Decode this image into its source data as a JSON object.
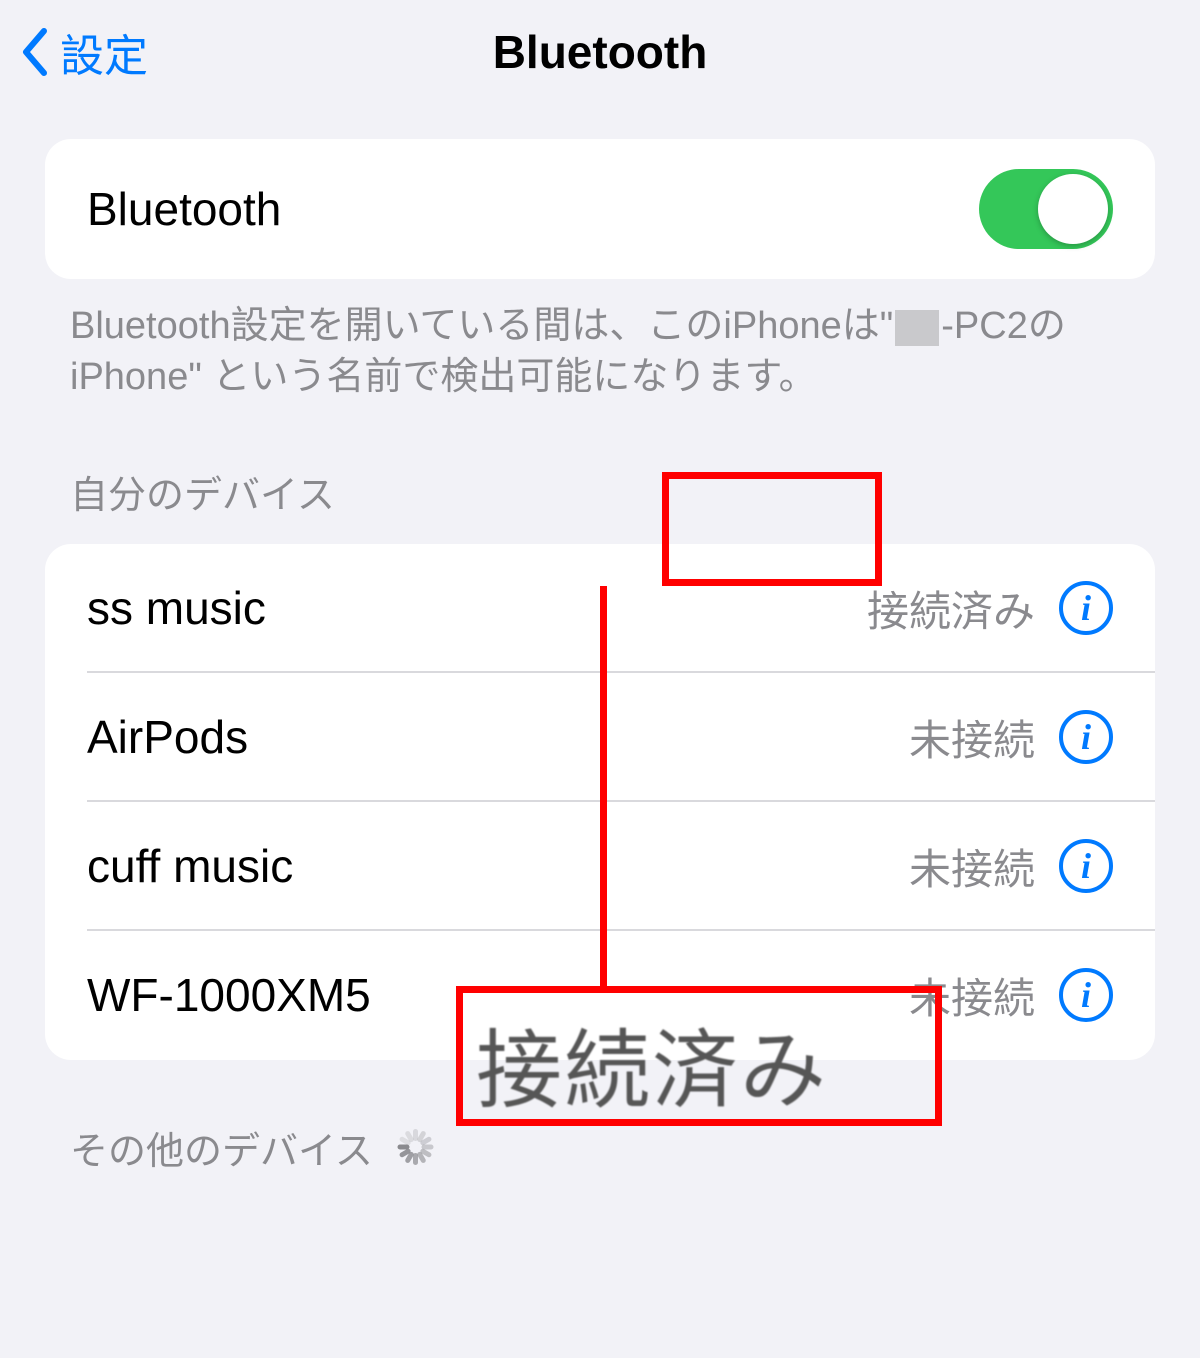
{
  "header": {
    "back_label": "設定",
    "title": "Bluetooth"
  },
  "toggle": {
    "label": "Bluetooth",
    "on": true
  },
  "note": {
    "part1": "Bluetooth設定を開いている間は、このiPhoneは\"",
    "part2": "-PC2のiPhone\" という名前で検出可能になります。"
  },
  "sections": {
    "my_devices": "自分のデバイス",
    "other_devices": "その他のデバイス"
  },
  "devices": [
    {
      "name": "ss music",
      "status": "接続済み"
    },
    {
      "name": "AirPods",
      "status": "未接続"
    },
    {
      "name": "cuff music",
      "status": "未接続"
    },
    {
      "name": "WF-1000XM5",
      "status": "未接続"
    }
  ],
  "annotation": {
    "callout_text": "接続済み"
  }
}
